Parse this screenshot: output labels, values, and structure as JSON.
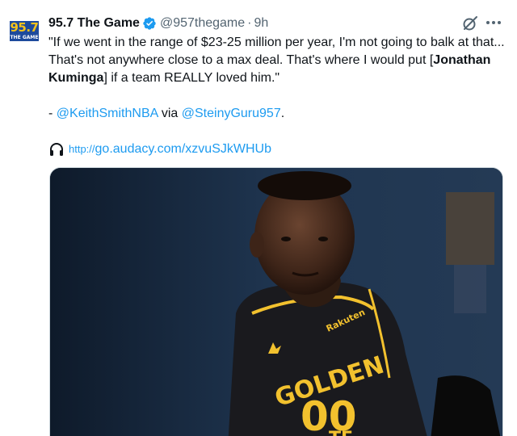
{
  "account": {
    "avatar_top": "95.7",
    "avatar_bottom": "THE GAME",
    "name": "95.7 The Game",
    "handle": "@957thegame",
    "separator": "·",
    "time": "9h"
  },
  "tweet": {
    "line1_pre": "\"If we went in the range of $23-25 million per year, I'm not going to balk at that... That's not anywhere close to a max deal. That's where I would put [",
    "line1_bold": "Jonathan Kuminga",
    "line1_post": "] if a team REALLY loved him.\"",
    "credit_prefix": "- ",
    "credit_mention1": "@KeithSmithNBA",
    "credit_via": " via ",
    "credit_mention2": "@SteinyGuru957",
    "credit_suffix": ".",
    "link_proto": "http://",
    "link_text": "go.audacy.com/xzvuSJkWHUb"
  },
  "photo": {
    "jersey_top": "GOLDEN",
    "jersey_number": "00",
    "jersey_sponsor": "Rakuten",
    "jersey_bottom": "TE"
  },
  "icons": {
    "verified": "verified-badge-icon",
    "grok": "grok-icon",
    "more": "more-icon",
    "headphones": "headphones-icon"
  },
  "colors": {
    "link": "#1d9bf0",
    "verified": "#1d9bf0",
    "secondary_text": "#536471",
    "jersey_accent": "#f2c12e"
  }
}
